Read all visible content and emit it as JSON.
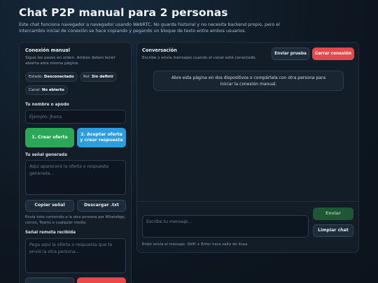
{
  "header": {
    "title": "Chat P2P manual para 2 personas",
    "intro": "Este chat funciona navegador a navegador usando WebRTC. No guarda historial y no necesita backend propio, pero el intercambio inicial de conexión se hace copiando y pegando un bloque de texto entre ambos usuarios."
  },
  "connection": {
    "title": "Conexión manual",
    "subtitle": "Sigue los pasos en orden. Ambos deben tener abierta esta misma página.",
    "status": {
      "label": "Estado:",
      "value": "Desconectado"
    },
    "role": {
      "label": "Rol:",
      "value": "Sin definir"
    },
    "channel": {
      "label": "Canal:",
      "value": "No abierto"
    },
    "name_label": "Tu nombre o apodo",
    "name_placeholder": "Ejemplo: Jhona",
    "name_value": "",
    "create_offer": "1. Crear oferta",
    "accept_offer": "2. Aceptar oferta y crear respuesta",
    "my_signal_label": "Tu señal generada",
    "my_signal_placeholder": "Aquí aparecerá la oferta o respuesta generada...",
    "copy_signal": "Copiar señal",
    "download_txt": "Descargar .txt",
    "send_hint": "Envía este contenido a la otra persona por WhatsApp, correo, Teams o cualquier medio.",
    "remote_signal_label": "Señal remota recibida",
    "remote_signal_placeholder": "Pega aquí la oferta o respuesta que te envió la otra persona..."
  },
  "conversation": {
    "title": "Conversación",
    "subtitle": "Escribe y envía mensajes cuando el canal esté conectado.",
    "send_test": "Enviar prueba",
    "close_connection": "Cerrar conexión",
    "notice": "Abre esta página en dos dispositivos o compártela con otra persona para iniciar la conexión manual.",
    "message_placeholder": "Escribe tu mensaje...",
    "send": "Enviar",
    "clear_chat": "Limpiar chat",
    "hint": "Enter envía el mensaje. Shift + Enter hace salto de línea."
  },
  "colors": {
    "background": "#0e1822",
    "panel": "#121d28",
    "accent_green": "#2aa857",
    "accent_blue": "#2b9de0",
    "danger_red": "#e5484d"
  }
}
